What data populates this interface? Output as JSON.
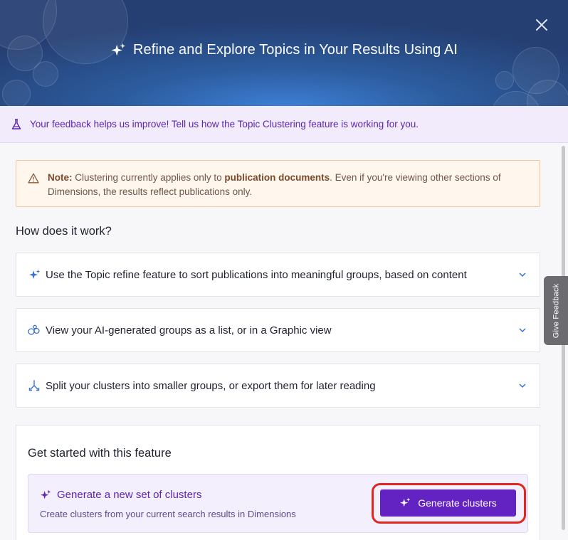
{
  "header": {
    "title": "Refine and Explore Topics in Your Results Using AI",
    "icon": "sparkle-icon",
    "close_icon": "close-icon"
  },
  "banner": {
    "icon": "flask-icon",
    "text": "Your feedback helps us improve! Tell us how the Topic Clustering feature is working for you."
  },
  "note": {
    "icon": "warning-icon",
    "prefix": "Note:",
    "part1": " Clustering currently applies only to ",
    "bold_term": "publication documents",
    "part2": ". Even if you're viewing other sections of Dimensions, the results reflect publications only."
  },
  "how_it_works": {
    "title": "How does it work?",
    "items": [
      {
        "icon": "sparkle-icon",
        "label": "Use the Topic refine feature to sort publications into meaningful groups, based on content"
      },
      {
        "icon": "bubbles-icon",
        "label": "View your AI-generated groups as a list, or in a Graphic view"
      },
      {
        "icon": "split-icon",
        "label": "Split your clusters into smaller groups, or export them for later reading"
      }
    ]
  },
  "get_started": {
    "title": "Get started with this feature",
    "generate": {
      "title": "Generate a new set of clusters",
      "subtitle": "Create clusters from your current search results in Dimensions",
      "button_label": "Generate clusters"
    }
  },
  "feedback_tab": {
    "label": "Give Feedback"
  },
  "colors": {
    "accent": "#6323c2",
    "banner_bg": "#f1ebfb",
    "note_bg": "#fff6ee",
    "highlight": "#e0261f"
  }
}
